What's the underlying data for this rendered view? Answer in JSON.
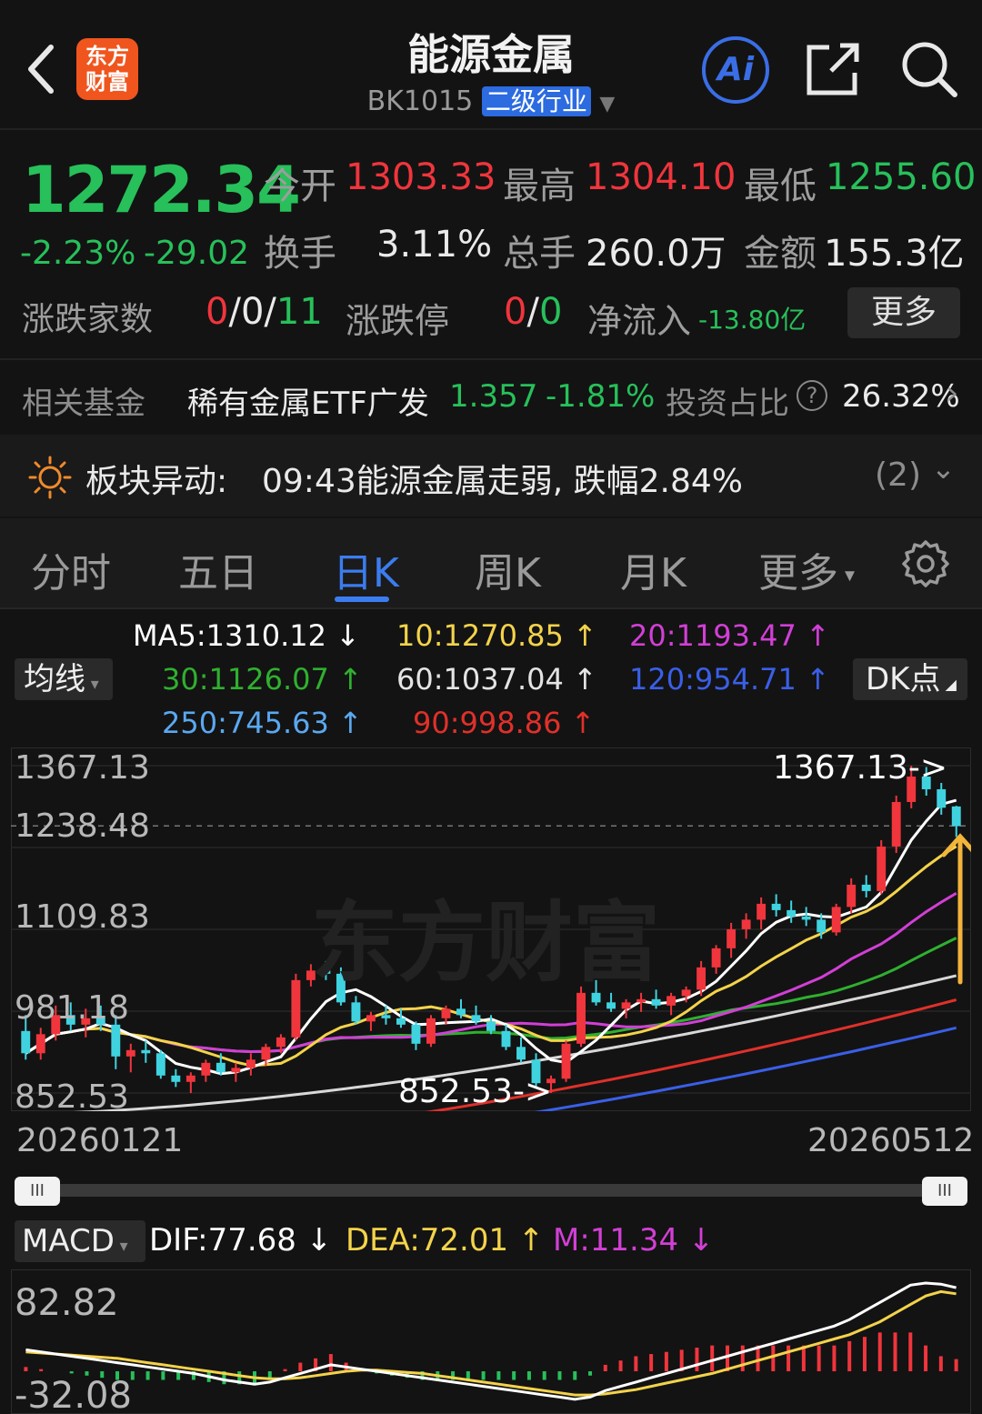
{
  "header": {
    "logo_text": "东方财富",
    "title": "能源金属",
    "code": "BK1015",
    "level_badge": "二级行业",
    "ai_label": "Ai"
  },
  "quote": {
    "price": "1272.34",
    "change_pct": "-2.23%",
    "change_val": "-29.02",
    "open_label": "今开",
    "open": "1303.33",
    "high_label": "最高",
    "high": "1304.10",
    "low_label": "最低",
    "low": "1255.60",
    "turnover_label": "换手",
    "turnover": "3.11%",
    "volume_label": "总手",
    "volume": "260.0万",
    "amount_label": "金额",
    "amount": "155.3亿",
    "updown_label": "涨跌家数",
    "updown_up": "0",
    "updown_flat": "0",
    "updown_down": "11",
    "limit_label": "涨跌停",
    "limit_up": "0",
    "limit_down": "0",
    "netflow_label": "净流入",
    "netflow": "-13.80亿",
    "more_label": "更多"
  },
  "fund": {
    "label": "相关基金",
    "name": "稀有金属ETF广发",
    "price": "1.357",
    "change": "-1.81%",
    "ratio_label": "投资占比",
    "ratio": "26.32%"
  },
  "alert": {
    "label": "板块异动:",
    "text": "09:43能源金属走弱, 跌幅2.84%",
    "count": "(2)"
  },
  "tabs": [
    "分时",
    "五日",
    "日K",
    "周K",
    "月K",
    "更多"
  ],
  "ma_legend": {
    "select_label": "均线",
    "ma5": "MA5:1310.12",
    "ma10": "10:1270.85",
    "ma20": "20:1193.47",
    "ma30": "30:1126.07",
    "ma60": "60:1037.04",
    "ma120": "120:954.71",
    "ma250": "250:745.63",
    "ma90": "90:998.86",
    "dk_label": "DK点"
  },
  "colors": {
    "up": "#f0353c",
    "down": "#27c05a",
    "candle_down": "#3fd3e0",
    "ma5": "#ffffff",
    "ma10": "#f4d34a",
    "ma20": "#d23fd6",
    "ma30": "#2fb02f",
    "ma60": "#d8d8d8",
    "ma90": "#e0302a",
    "ma120": "#3a5fe8",
    "ma250": "#5aa8f0",
    "accent": "#3b7df0"
  },
  "chart_data": [
    {
      "type": "candlestick",
      "title": "",
      "y_labels": [
        "1367.13",
        "1238.48",
        "1109.83",
        "981.18",
        "852.53"
      ],
      "ylim": [
        852.53,
        1367.13
      ],
      "x_labels": [
        "20260121",
        "20260512"
      ],
      "annotations": [
        "1367.13",
        "852.53"
      ],
      "reference_line": 1272.34,
      "candles": [
        {
          "o": 950,
          "h": 975,
          "l": 905,
          "c": 915
        },
        {
          "o": 915,
          "h": 955,
          "l": 905,
          "c": 945
        },
        {
          "o": 945,
          "h": 990,
          "l": 935,
          "c": 975
        },
        {
          "o": 975,
          "h": 995,
          "l": 950,
          "c": 960
        },
        {
          "o": 960,
          "h": 985,
          "l": 940,
          "c": 970
        },
        {
          "o": 970,
          "h": 990,
          "l": 950,
          "c": 960
        },
        {
          "o": 960,
          "h": 975,
          "l": 890,
          "c": 910
        },
        {
          "o": 910,
          "h": 930,
          "l": 885,
          "c": 920
        },
        {
          "o": 920,
          "h": 935,
          "l": 900,
          "c": 915
        },
        {
          "o": 915,
          "h": 920,
          "l": 875,
          "c": 880
        },
        {
          "o": 880,
          "h": 890,
          "l": 862,
          "c": 870
        },
        {
          "o": 870,
          "h": 885,
          "l": 845,
          "c": 880
        },
        {
          "o": 880,
          "h": 905,
          "l": 870,
          "c": 900
        },
        {
          "o": 900,
          "h": 915,
          "l": 880,
          "c": 885
        },
        {
          "o": 885,
          "h": 900,
          "l": 870,
          "c": 892
        },
        {
          "o": 892,
          "h": 915,
          "l": 880,
          "c": 905
        },
        {
          "o": 905,
          "h": 930,
          "l": 895,
          "c": 925
        },
        {
          "o": 925,
          "h": 945,
          "l": 915,
          "c": 940
        },
        {
          "o": 940,
          "h": 1040,
          "l": 935,
          "c": 1030
        },
        {
          "o": 1030,
          "h": 1055,
          "l": 1020,
          "c": 1045
        },
        {
          "o": 1045,
          "h": 1060,
          "l": 1030,
          "c": 1040
        },
        {
          "o": 1040,
          "h": 1050,
          "l": 990,
          "c": 995
        },
        {
          "o": 995,
          "h": 1005,
          "l": 960,
          "c": 965
        },
        {
          "o": 965,
          "h": 980,
          "l": 950,
          "c": 975
        },
        {
          "o": 975,
          "h": 990,
          "l": 960,
          "c": 970
        },
        {
          "o": 970,
          "h": 985,
          "l": 955,
          "c": 960
        },
        {
          "o": 960,
          "h": 965,
          "l": 920,
          "c": 930
        },
        {
          "o": 930,
          "h": 975,
          "l": 925,
          "c": 970
        },
        {
          "o": 970,
          "h": 990,
          "l": 960,
          "c": 985
        },
        {
          "o": 985,
          "h": 1000,
          "l": 970,
          "c": 975
        },
        {
          "o": 975,
          "h": 990,
          "l": 960,
          "c": 965
        },
        {
          "o": 965,
          "h": 975,
          "l": 945,
          "c": 950
        },
        {
          "o": 950,
          "h": 960,
          "l": 920,
          "c": 925
        },
        {
          "o": 925,
          "h": 940,
          "l": 900,
          "c": 905
        },
        {
          "o": 905,
          "h": 915,
          "l": 860,
          "c": 868
        },
        {
          "o": 868,
          "h": 880,
          "l": 850,
          "c": 875
        },
        {
          "o": 875,
          "h": 935,
          "l": 870,
          "c": 930
        },
        {
          "o": 930,
          "h": 1020,
          "l": 925,
          "c": 1010
        },
        {
          "o": 1010,
          "h": 1030,
          "l": 990,
          "c": 995
        },
        {
          "o": 995,
          "h": 1010,
          "l": 980,
          "c": 985
        },
        {
          "o": 985,
          "h": 1000,
          "l": 970,
          "c": 995
        },
        {
          "o": 995,
          "h": 1010,
          "l": 980,
          "c": 1000
        },
        {
          "o": 1000,
          "h": 1015,
          "l": 985,
          "c": 990
        },
        {
          "o": 990,
          "h": 1010,
          "l": 975,
          "c": 1005
        },
        {
          "o": 1005,
          "h": 1020,
          "l": 995,
          "c": 1015
        },
        {
          "o": 1015,
          "h": 1060,
          "l": 1005,
          "c": 1050
        },
        {
          "o": 1050,
          "h": 1085,
          "l": 1040,
          "c": 1080
        },
        {
          "o": 1080,
          "h": 1120,
          "l": 1065,
          "c": 1110
        },
        {
          "o": 1110,
          "h": 1135,
          "l": 1095,
          "c": 1125
        },
        {
          "o": 1125,
          "h": 1160,
          "l": 1110,
          "c": 1150
        },
        {
          "o": 1150,
          "h": 1165,
          "l": 1130,
          "c": 1140
        },
        {
          "o": 1140,
          "h": 1155,
          "l": 1120,
          "c": 1130
        },
        {
          "o": 1130,
          "h": 1145,
          "l": 1115,
          "c": 1125
        },
        {
          "o": 1125,
          "h": 1135,
          "l": 1095,
          "c": 1105
        },
        {
          "o": 1105,
          "h": 1150,
          "l": 1100,
          "c": 1145
        },
        {
          "o": 1145,
          "h": 1190,
          "l": 1135,
          "c": 1180
        },
        {
          "o": 1180,
          "h": 1195,
          "l": 1160,
          "c": 1170
        },
        {
          "o": 1170,
          "h": 1250,
          "l": 1165,
          "c": 1240
        },
        {
          "o": 1240,
          "h": 1320,
          "l": 1230,
          "c": 1310
        },
        {
          "o": 1310,
          "h": 1367,
          "l": 1300,
          "c": 1350
        },
        {
          "o": 1350,
          "h": 1365,
          "l": 1320,
          "c": 1330
        },
        {
          "o": 1330,
          "h": 1340,
          "l": 1290,
          "c": 1301
        },
        {
          "o": 1303,
          "h": 1304,
          "l": 1255,
          "c": 1272
        }
      ]
    },
    {
      "type": "macd",
      "select_label": "MACD",
      "dif_label": "DIF:77.68",
      "dea_label": "DEA:72.01",
      "m_label": "M:11.34",
      "y_labels": [
        "82.82",
        "-32.08"
      ],
      "ylim": [
        -32.08,
        82.82
      ],
      "dif": [
        20,
        18,
        16,
        14,
        12,
        10,
        8,
        6,
        4,
        2,
        0,
        -2,
        -5,
        -8,
        -10,
        -12,
        -10,
        -6,
        -2,
        2,
        6,
        4,
        2,
        0,
        -2,
        -4,
        -6,
        -8,
        -10,
        -12,
        -14,
        -16,
        -18,
        -20,
        -22,
        -24,
        -26,
        -24,
        -18,
        -14,
        -10,
        -6,
        -2,
        2,
        6,
        10,
        14,
        18,
        22,
        26,
        30,
        34,
        38,
        42,
        48,
        56,
        64,
        72,
        80,
        82,
        81,
        77.68
      ],
      "dea": [
        18,
        17,
        16,
        15,
        14,
        13,
        12,
        10,
        8,
        6,
        4,
        2,
        0,
        -2,
        -4,
        -6,
        -7,
        -7,
        -6,
        -4,
        -2,
        0,
        1,
        1,
        0,
        -1,
        -2,
        -4,
        -6,
        -8,
        -10,
        -12,
        -14,
        -16,
        -18,
        -20,
        -22,
        -22,
        -21,
        -19,
        -17,
        -14,
        -11,
        -8,
        -5,
        -2,
        2,
        6,
        10,
        14,
        18,
        22,
        26,
        30,
        34,
        40,
        46,
        54,
        62,
        70,
        74,
        72.01
      ],
      "m": [
        4,
        2,
        0,
        -2,
        -4,
        -6,
        -8,
        -8,
        -8,
        -8,
        -8,
        -8,
        -10,
        -12,
        -12,
        -12,
        -6,
        2,
        8,
        12,
        16,
        8,
        2,
        -2,
        -4,
        -6,
        -8,
        -8,
        -8,
        -8,
        -8,
        -8,
        -8,
        -8,
        -8,
        -8,
        -8,
        -4,
        6,
        10,
        14,
        16,
        18,
        20,
        22,
        24,
        24,
        24,
        24,
        24,
        24,
        24,
        24,
        24,
        28,
        32,
        36,
        36,
        36,
        24,
        14,
        11.34
      ]
    }
  ]
}
